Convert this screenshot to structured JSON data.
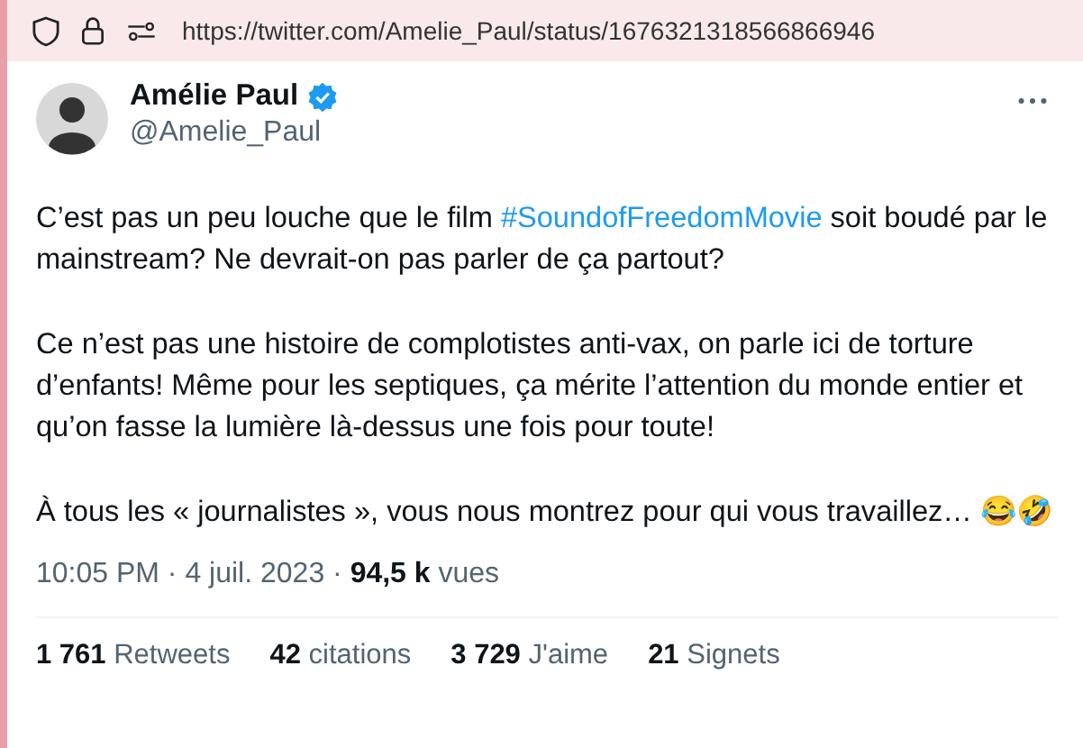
{
  "address_bar": {
    "url": "https://twitter.com/Amelie_Paul/status/1676321318566866946"
  },
  "tweet": {
    "author": {
      "name": "Amélie Paul",
      "handle": "@Amelie_Paul",
      "verified": true
    },
    "paragraphs": [
      [
        {
          "kind": "plain",
          "text": "C’est pas un peu louche que le film "
        },
        {
          "kind": "hashtag",
          "text": "#SoundofFreedomMovie"
        },
        {
          "kind": "plain",
          "text": " soit boudé par le mainstream? Ne devrait-on pas parler de ça partout?"
        }
      ],
      [
        {
          "kind": "plain",
          "text": "Ce n’est pas une histoire de complotistes anti-vax, on parle ici de torture d’enfants! Même pour les septiques, ça mérite l’attention du monde entier et qu’on fasse la lumière là-dessus une fois pour toute!"
        }
      ],
      [
        {
          "kind": "plain",
          "text": "À tous les « journalistes », vous nous montrez pour qui vous travaillez… 😂🤣"
        }
      ]
    ],
    "meta": "10:05 PM · 4 juil. 2023 · **94,5 k** vues",
    "stats": [
      "**1 761** Retweets",
      "**42** citations",
      "**3 729** J'aime",
      "**21** Signets"
    ]
  }
}
